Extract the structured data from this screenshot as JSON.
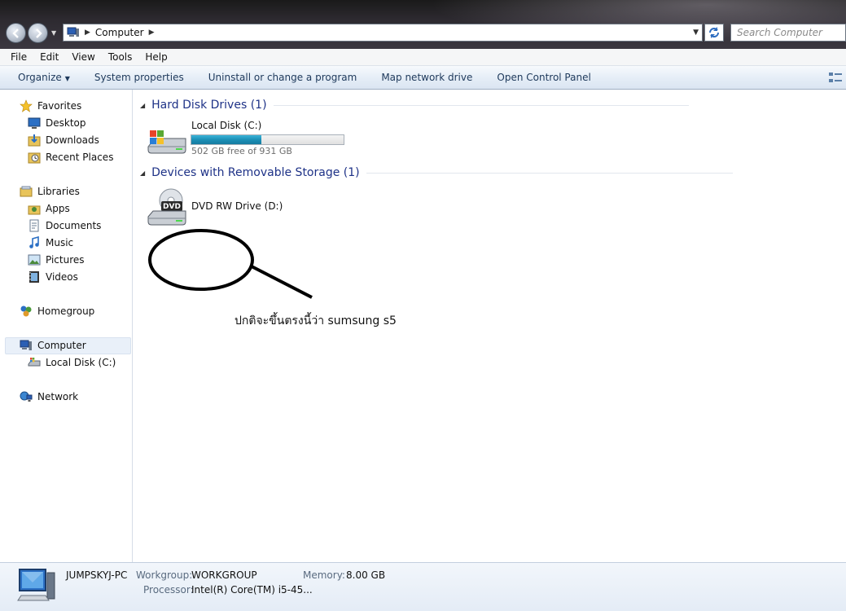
{
  "address": {
    "crumb": "Computer",
    "search_placeholder": "Search Computer"
  },
  "menu": [
    "File",
    "Edit",
    "View",
    "Tools",
    "Help"
  ],
  "commands": {
    "organize": "Organize",
    "system_properties": "System properties",
    "uninstall": "Uninstall or change a program",
    "map_drive": "Map network drive",
    "control_panel": "Open Control Panel"
  },
  "nav": {
    "favorites": "Favorites",
    "desktop": "Desktop",
    "downloads": "Downloads",
    "recent": "Recent Places",
    "libraries": "Libraries",
    "apps": "Apps",
    "documents": "Documents",
    "music": "Music",
    "pictures": "Pictures",
    "videos": "Videos",
    "homegroup": "Homegroup",
    "computer": "Computer",
    "local_disk": "Local Disk (C:)",
    "network": "Network"
  },
  "groups": {
    "hdd_title": "Hard Disk Drives (1)",
    "removable_title": "Devices with Removable Storage (1)"
  },
  "drives": {
    "c_name": "Local Disk (C:)",
    "c_free": "502 GB free of 931 GB",
    "c_used_fraction": 0.46,
    "dvd_name": "DVD RW Drive (D:)",
    "dvd_label": "DVD"
  },
  "annotation": {
    "text": "ปกติจะขึ้นตรงนี้ว่า   sumsung s5"
  },
  "details": {
    "pc_name": "JUMPSKYJ-PC",
    "workgroup_label": "Workgroup:",
    "workgroup": "WORKGROUP",
    "memory_label": "Memory:",
    "memory": "8.00 GB",
    "processor_label": "Processor:",
    "processor": "Intel(R) Core(TM) i5-45..."
  },
  "colors": {
    "accent": "#1e3287",
    "command_text": "#1e395b",
    "disk_bar": "#1c8fb6"
  }
}
